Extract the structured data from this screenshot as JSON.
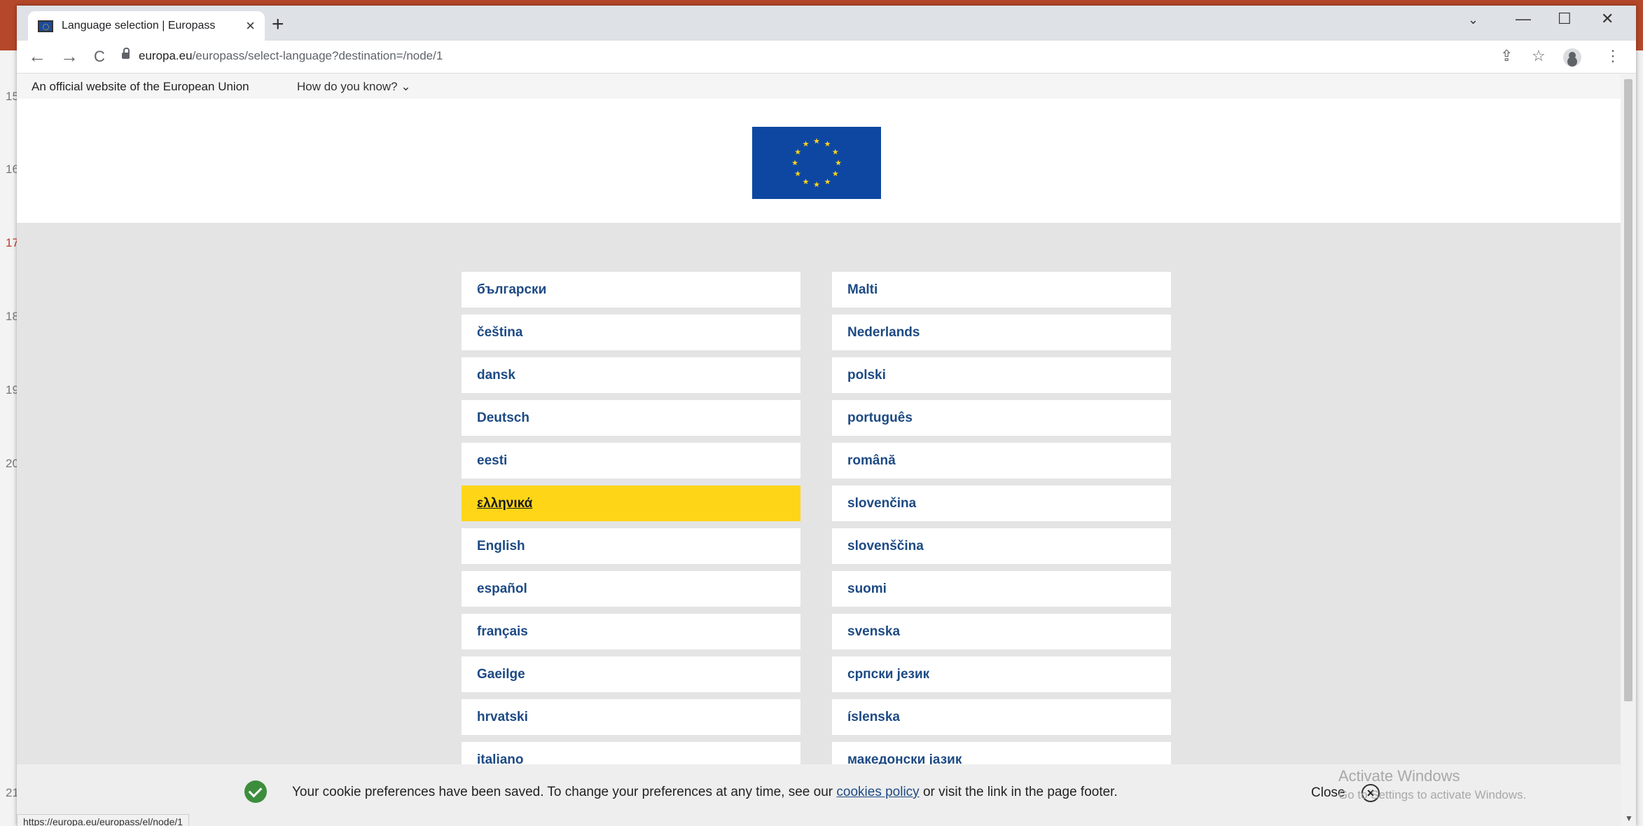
{
  "background": {
    "left_numbers": [
      "15",
      "16",
      "17",
      "18",
      "19",
      "20",
      "21"
    ]
  },
  "browser": {
    "tab_title": "Language selection | Europass",
    "tab_close": "×",
    "new_tab": "+",
    "url_host": "europa.eu",
    "url_path": "/europass/select-language?destination=/node/1",
    "status_url": "https://europa.eu/europass/el/node/1",
    "controls": {
      "back": "←",
      "forward": "→",
      "reload": "C",
      "minimize": "—",
      "maximize": "☐",
      "close": "✕",
      "tab_menu": "⌄"
    }
  },
  "eu_banner": {
    "official_text": "An official website of the European Union",
    "how_do_you_know": "How do you know?"
  },
  "languages": {
    "left": [
      "български",
      "čeština",
      "dansk",
      "Deutsch",
      "eesti",
      "ελληνικά",
      "English",
      "español",
      "français",
      "Gaeilge",
      "hrvatski",
      "italiano"
    ],
    "right": [
      "Malti",
      "Nederlands",
      "polski",
      "português",
      "română",
      "slovenčina",
      "slovenščina",
      "suomi",
      "svenska",
      "српски језик",
      "íslenska",
      "македонски јазик"
    ],
    "active": "ελληνικά"
  },
  "cookie": {
    "text_before": "Your cookie preferences have been saved. To change your preferences at any time, see our",
    "link": "cookies policy",
    "text_after": "or visit the link in the page footer.",
    "close": "Close"
  },
  "watermark": {
    "line1": "Activate Windows",
    "line2": "Go to Settings to activate Windows."
  },
  "colors": {
    "accent": "#ffd617",
    "link": "#1d4a84",
    "flag": "#0e47a1"
  }
}
